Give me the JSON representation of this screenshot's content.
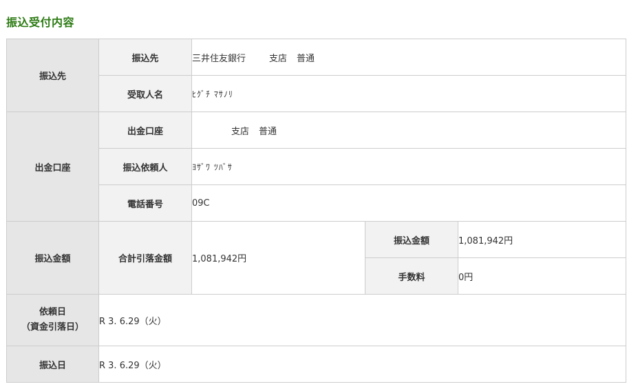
{
  "page": {
    "title": "振込受付内容"
  },
  "payee": {
    "section_label": "振込先",
    "destination_label": "振込先",
    "bank_name": "三井住友銀行",
    "branch": "支店",
    "account_type": "普通",
    "recipient_label": "受取人名",
    "recipient_name": "ﾋｸﾞﾁ ﾏｻﾉﾘ"
  },
  "source": {
    "section_label": "出金口座",
    "account_label": "出金口座",
    "branch": "支店",
    "account_type": "普通",
    "requester_label": "振込依頼人",
    "requester_name": "ﾖｻﾞﾜ ﾂﾊﾞｻ",
    "phone_label": "電話番号",
    "phone_value": "09C"
  },
  "amount": {
    "section_label": "振込金額",
    "total_label": "合計引落金額",
    "total_value": "1,081,942円",
    "transfer_label": "振込金額",
    "transfer_value": "1,081,942円",
    "fee_label": "手数料",
    "fee_value": "0円"
  },
  "request_date": {
    "label_line1": "依頼日",
    "label_line2": "（資金引落日）",
    "value": "R 3. 6.29（火）"
  },
  "transfer_date": {
    "label": "振込日",
    "value": "R 3. 6.29（火）"
  }
}
